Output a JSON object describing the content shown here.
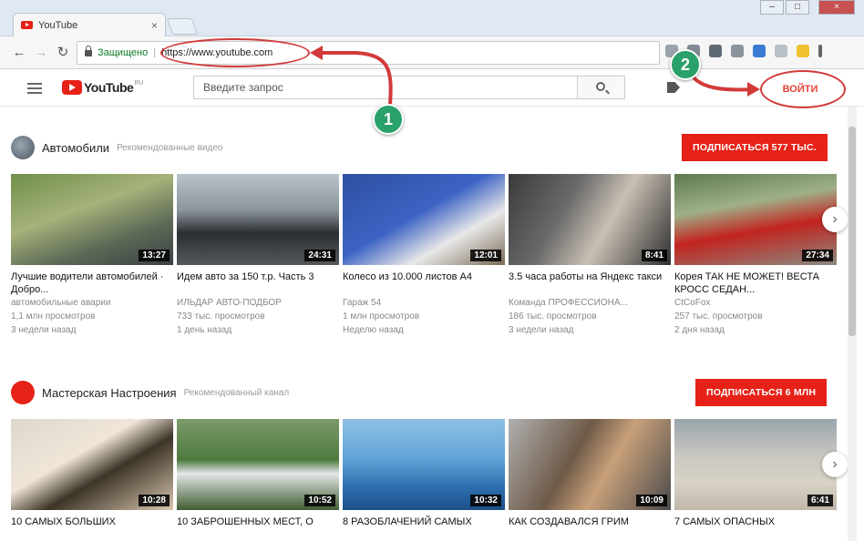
{
  "browser": {
    "tab_title": "YouTube",
    "tab_close": "×",
    "nav": {
      "back": "←",
      "forward": "→",
      "reload": "↻"
    },
    "secure_label": "Защищено",
    "url_sep": "|",
    "url": "https://www.youtube.com",
    "window": {
      "minimize": "–",
      "maximize": "□",
      "close": "×"
    }
  },
  "youtube": {
    "logo_text": "YouTube",
    "logo_region": "RU",
    "search_placeholder": "Введите запрос",
    "signin_label": "ВОЙТИ"
  },
  "annotations": [
    {
      "label": "1"
    },
    {
      "label": "2"
    }
  ],
  "shelves": [
    {
      "channel": "Автомобили",
      "meta": "Рекомендованные видео",
      "subscribe": "ПОДПИСАТЬСЯ  577 ТЫС.",
      "videos": [
        {
          "title": "Лучшие водители автомобилей · Добро...",
          "channel": "автомобильные аварии",
          "views": "1,1 млн просмотров",
          "date": "3 недели назад",
          "duration": "13:27"
        },
        {
          "title": "Идем авто за 150 т.р. Часть 3",
          "channel": "ИЛЬДАР АВТО-ПОДБОР",
          "views": "733 тыс. просмотров",
          "date": "1 день назад",
          "duration": "24:31"
        },
        {
          "title": "Колесо из 10.000 листов А4",
          "channel": "Гараж 54",
          "views": "1 млн просмотров",
          "date": "Неделю назад",
          "duration": "12:01"
        },
        {
          "title": "3.5 часа работы на Яндекс такси",
          "channel": "Команда ПРОФЕССИОНА...",
          "views": "186 тыс. просмотров",
          "date": "3 недели назад",
          "duration": "8:41"
        },
        {
          "title": "Корея ТАК НЕ МОЖЕТ! ВЕСТА КРОСС СЕДАН...",
          "channel": "CtCoFox",
          "views": "257 тыс. просмотров",
          "date": "2 дня назад",
          "duration": "27:34"
        }
      ]
    },
    {
      "channel": "Мастерская Настроения",
      "meta": "Рекомендованный канал",
      "subscribe": "ПОДПИСАТЬСЯ  6 МЛН",
      "videos": [
        {
          "title": "10 САМЫХ БОЛЬШИХ",
          "duration": "10:28"
        },
        {
          "title": "10 ЗАБРОШЕННЫХ МЕСТ, О",
          "duration": "10:52"
        },
        {
          "title": "8 РАЗОБЛАЧЕНИЙ САМЫХ",
          "duration": "10:32"
        },
        {
          "title": "КАК СОЗДАВАЛСЯ ГРИМ",
          "duration": "10:09"
        },
        {
          "title": "7 САМЫХ ОПАСНЫХ",
          "duration": "6:41"
        }
      ]
    }
  ],
  "next_glyph": "›",
  "colors": {
    "brand_red": "#e62117",
    "annotation_green": "#2aa06a",
    "highlight_red": "#d23a3a"
  }
}
